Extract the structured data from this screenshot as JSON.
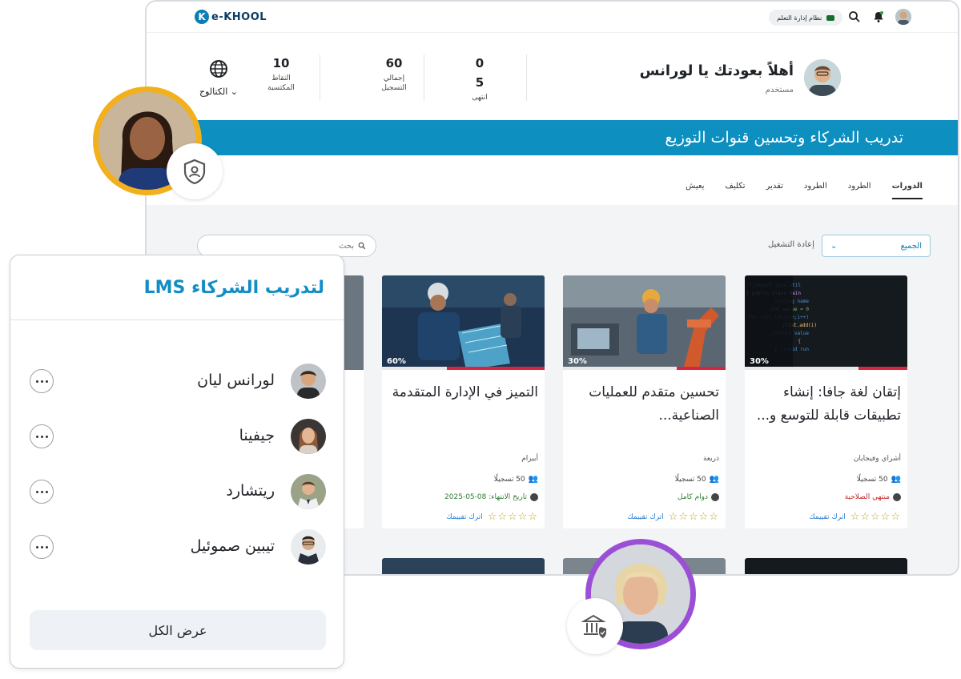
{
  "app": {
    "logo_mark": "K",
    "logo_text": "e-KHOOL",
    "lms_pill": "نظام إدارة التعلم",
    "welcome_title": "أهلاً بعودتك يا لورانس",
    "welcome_role": "مستخدم",
    "stats": [
      {
        "value": "0",
        "label": ""
      },
      {
        "value": "5",
        "label": "انتهى"
      },
      {
        "value": "60",
        "label": "إجمالي التسجيل"
      },
      {
        "value": "10",
        "label": "النقاط المكتسبة"
      }
    ],
    "catalog_label": "الكتالوج",
    "banner_title": "تدريب الشركاء وتحسين قنوات التوزيع",
    "tabs": [
      "الدورات",
      "الطرود",
      "الطرود",
      "تقدير",
      "تكليف",
      "يعيش"
    ],
    "filter_value": "الجميع",
    "reset_label": "إعادة التشغيل",
    "search_placeholder": "بحث"
  },
  "courses": [
    {
      "title": "إتقان لغة جافا: إنشاء تطبيقات قابلة للتوسع و...",
      "author": "أشراي وفيجايان",
      "enrolled": "50 تسجيلًا",
      "status": "منتهي الصلاحية",
      "status_color": "#c62828",
      "progress": 30,
      "progress_label": "30%",
      "rate_label": "اترك تقييمك",
      "stars": "☆☆☆☆☆"
    },
    {
      "title": "تحسين متقدم للعمليات الصناعية...",
      "author": "ذريعة",
      "enrolled": "50 تسجيلًا",
      "status": "دوام كامل",
      "status_color": "#2e7d32",
      "progress": 30,
      "progress_label": "30%",
      "rate_label": "اترك تقييمك",
      "stars": "☆☆☆☆☆"
    },
    {
      "title": "التميز في الإدارة المتقدمة",
      "author": "أبيرام",
      "enrolled": "50 تسجيلًا",
      "status": "تاريخ الانتهاء: 08-05-2025",
      "status_color": "#2e7d32",
      "progress": 60,
      "progress_label": "60%",
      "rate_label": "اترك تقييمك",
      "stars": "☆☆☆☆☆"
    }
  ],
  "panel": {
    "title": "لتدريب الشركاء LMS",
    "people": [
      {
        "name": "لورانس ليان"
      },
      {
        "name": "جيفينا"
      },
      {
        "name": "ريتشارد"
      },
      {
        "name": "تيبين صموئيل"
      }
    ],
    "view_all": "عرض الكل"
  },
  "colors": {
    "brand": "#0d8fc0",
    "progress": "#d7263d",
    "star": "#c9a227",
    "link": "#2a7ed1",
    "ring_yellow": "#f2b11c",
    "ring_purple": "#9b4fd6"
  }
}
